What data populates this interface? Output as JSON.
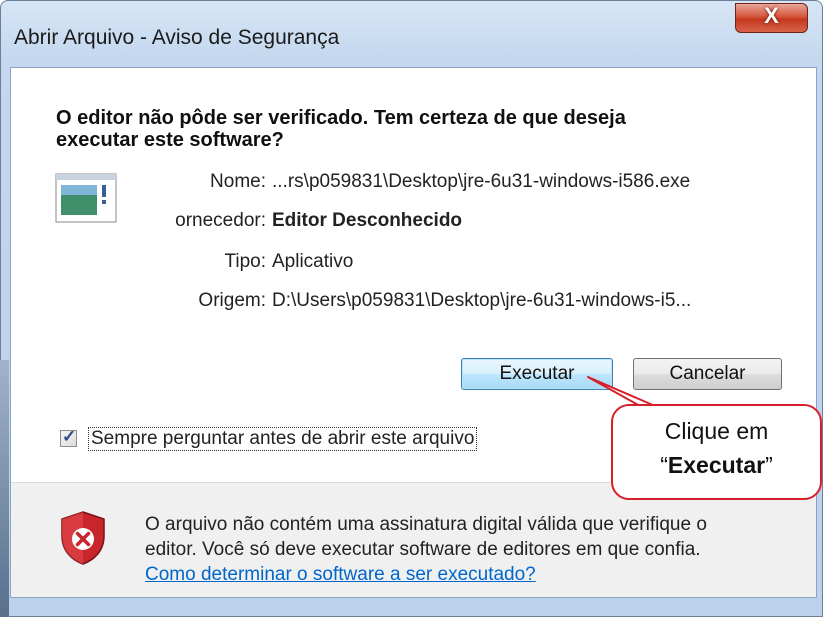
{
  "window": {
    "title": "Abrir Arquivo - Aviso de Segurança",
    "close_glyph": "X"
  },
  "heading": {
    "line1": "O editor não pôde ser verificado. Tem certeza de que deseja",
    "line2": "executar este software?"
  },
  "details": {
    "name_label": "Nome:",
    "name_value": "...rs\\p059831\\Desktop\\jre-6u31-windows-i586.exe",
    "publisher_label": "ornecedor:",
    "publisher_value": "Editor Desconhecido",
    "type_label": "Tipo:",
    "type_value": "Aplicativo",
    "origin_label": "Origem:",
    "origin_value": "D:\\Users\\p059831\\Desktop\\jre-6u31-windows-i5..."
  },
  "buttons": {
    "run_label": "Executar",
    "cancel_label": "Cancelar"
  },
  "checkbox": {
    "label": "Sempre perguntar antes de abrir este arquivo",
    "checked": true
  },
  "footer": {
    "line1": "O arquivo não contém uma assinatura digital válida que verifique o",
    "line2": "editor. Você só deve executar software de editores em que confia.",
    "link": "Como determinar o software a ser executado?"
  },
  "callout": {
    "line1": "Clique em",
    "line2_open": "“",
    "line2_bold": "Executar",
    "line2_close": "”"
  },
  "colors": {
    "accent_red": "#d8202a",
    "link": "#0066cc"
  },
  "icons": [
    "app-window-icon",
    "shield-error-icon",
    "close-icon",
    "check-icon"
  ]
}
